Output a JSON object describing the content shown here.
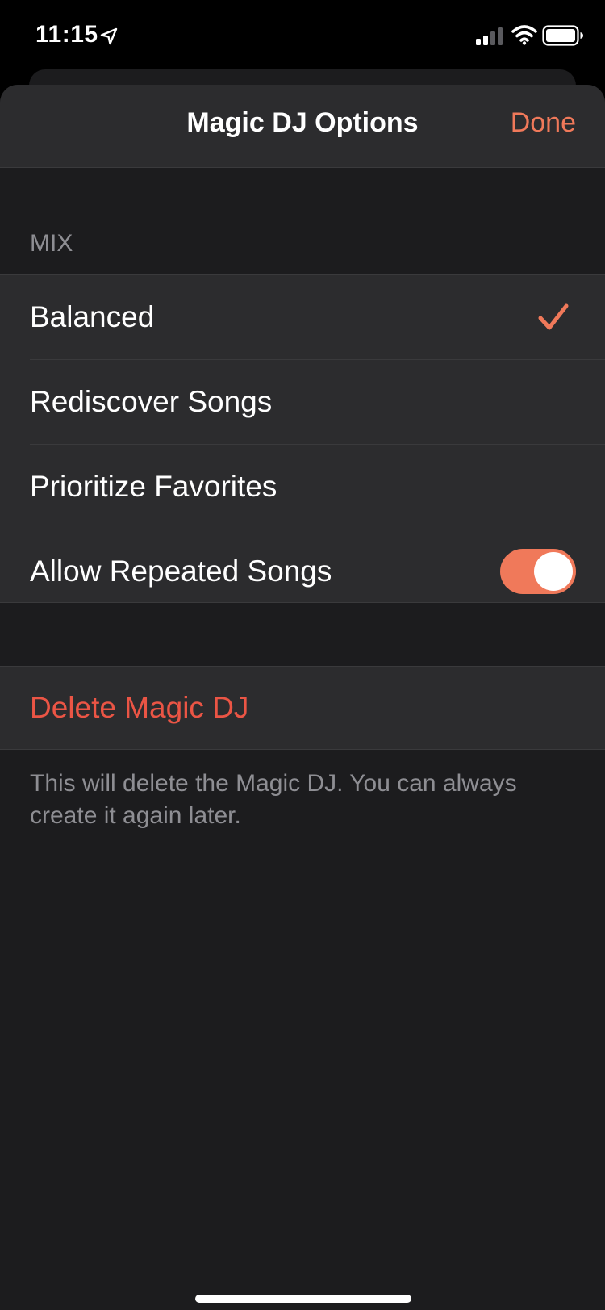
{
  "status_bar": {
    "time": "11:15",
    "icons": [
      "location-arrow-icon",
      "cellular-signal-icon",
      "wifi-icon",
      "battery-icon"
    ]
  },
  "header": {
    "title": "Magic DJ Options",
    "done_label": "Done"
  },
  "mix_section": {
    "header": "MIX",
    "items": [
      {
        "label": "Balanced",
        "selected": true
      },
      {
        "label": "Rediscover Songs",
        "selected": false
      },
      {
        "label": "Prioritize Favorites",
        "selected": false
      }
    ],
    "toggle": {
      "label": "Allow Repeated Songs",
      "on": true
    }
  },
  "delete_section": {
    "label": "Delete Magic DJ",
    "note": "This will delete the Magic DJ. You can always create it again later."
  },
  "colors": {
    "accent": "#f0795a",
    "destructive": "#eb5545",
    "background": "#1c1c1e",
    "cell": "#2c2c2e",
    "secondary_text": "#8e8e93"
  }
}
